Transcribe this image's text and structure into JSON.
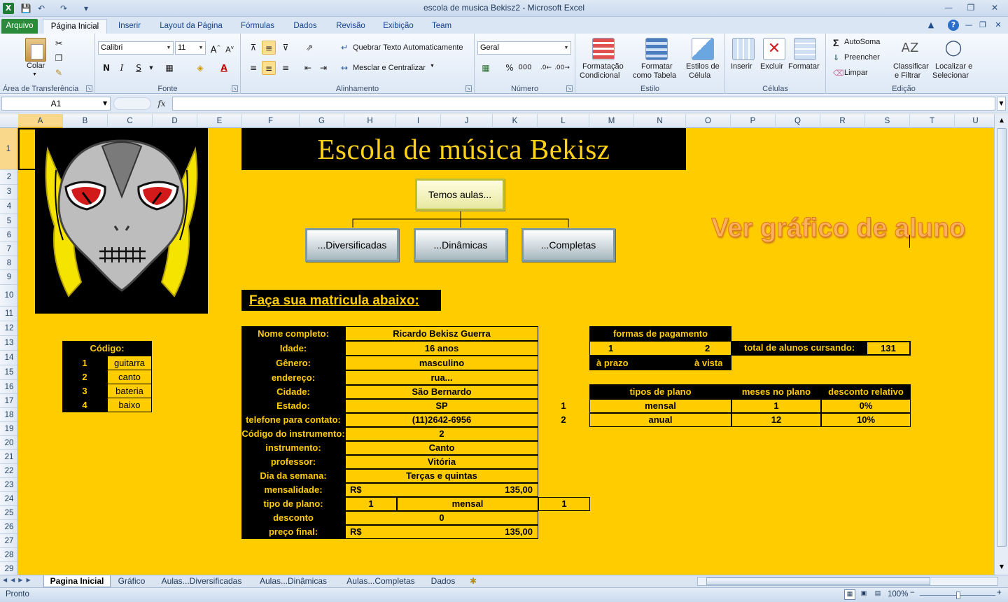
{
  "window": {
    "title": "escola de musica Bekisz2  -  Microsoft Excel"
  },
  "ribbon_tabs": [
    "Arquivo",
    "Página Inicial",
    "Inserir",
    "Layout da Página",
    "Fórmulas",
    "Dados",
    "Revisão",
    "Exibição",
    "Team"
  ],
  "ribbon": {
    "clipboard": {
      "colar": "Colar",
      "label": "Área de Transferência"
    },
    "font": {
      "name": "Calibri",
      "size": "11",
      "label": "Fonte",
      "bold": "N",
      "italic": "I",
      "underline": "S"
    },
    "alignment": {
      "wrap": "Quebrar Texto Automaticamente",
      "merge": "Mesclar e Centralizar",
      "label": "Alinhamento"
    },
    "number": {
      "format": "Geral",
      "label": "Número",
      "percent": "%",
      "thousands": "000"
    },
    "styles": {
      "cond1": "Formatação",
      "cond2": "Condicional",
      "table1": "Formatar",
      "table2": "como Tabela",
      "cell1": "Estilos de",
      "cell2": "Célula",
      "label": "Estilo"
    },
    "cells": {
      "insert": "Inserir",
      "delete": "Excluir",
      "format": "Formatar",
      "label": "Células"
    },
    "editing": {
      "autosum": "AutoSoma",
      "fill": "Preencher",
      "clear": "Limpar",
      "sort1": "Classificar",
      "sort2": "e Filtrar",
      "find1": "Localizar e",
      "find2": "Selecionar",
      "label": "Edição"
    }
  },
  "formula_bar": {
    "name_box": "A1",
    "fx": "fx",
    "value": ""
  },
  "columns": [
    "A",
    "B",
    "C",
    "D",
    "E",
    "F",
    "G",
    "H",
    "I",
    "J",
    "K",
    "L",
    "M",
    "N",
    "O",
    "P",
    "Q",
    "R",
    "S",
    "T",
    "U"
  ],
  "rows": [
    "1",
    "2",
    "3",
    "4",
    "5",
    "6",
    "7",
    "8",
    "9",
    "10",
    "11",
    "12",
    "13",
    "14",
    "15",
    "16",
    "17",
    "18",
    "19",
    "20",
    "21",
    "22",
    "23",
    "24",
    "25",
    "26",
    "27",
    "28",
    "29"
  ],
  "sheet": {
    "banner": "Escola de música Bekisz",
    "org": {
      "top": "Temos aulas...",
      "children": [
        "...Diversificadas",
        "...Dinâmicas",
        "...Completas"
      ]
    },
    "chart_link": "Ver gráfico de aluno",
    "enroll_title": "Faça sua matricula abaixo:",
    "codes": {
      "header": "Código:",
      "items": [
        {
          "n": "1",
          "name": "guitarra"
        },
        {
          "n": "2",
          "name": "canto"
        },
        {
          "n": "3",
          "name": "bateria"
        },
        {
          "n": "4",
          "name": "baixo"
        }
      ]
    },
    "form": [
      {
        "label": "Nome completo:",
        "value": "Ricardo Bekisz Guerra"
      },
      {
        "label": "Idade:",
        "value": "16 anos"
      },
      {
        "label": "Gênero:",
        "value": "masculino"
      },
      {
        "label": "endereço:",
        "value": "rua..."
      },
      {
        "label": "Cidade:",
        "value": "São Bernardo"
      },
      {
        "label": "Estado:",
        "value": "SP"
      },
      {
        "label": "telefone para contato:",
        "value": "(11)2642-6956"
      },
      {
        "label": "Código do instrumento:",
        "value": "2"
      },
      {
        "label": "instrumento:",
        "value": "Canto"
      },
      {
        "label": "professor:",
        "value": "Vitória"
      },
      {
        "label": "Dia da semana:",
        "value": "Terças e quintas"
      },
      {
        "label": "mensalidade:",
        "currency": "R$",
        "value": "135,00"
      },
      {
        "label": "tipo de plano:",
        "v1": "1",
        "v2": "mensal",
        "v3": "1"
      },
      {
        "label": "desconto",
        "value": "0"
      },
      {
        "label": "preço final:",
        "currency": "R$",
        "value": "135,00"
      }
    ],
    "side_numbers": [
      "1",
      "2"
    ],
    "payment": {
      "header": "formas de pagamento",
      "n1": "1",
      "n2": "2",
      "l1": "à prazo",
      "l2": "à vista"
    },
    "total": {
      "label": "total de alunos cursando:",
      "value": "131"
    },
    "plans": {
      "headers": [
        "tipos de plano",
        "meses no plano",
        "desconto relativo"
      ],
      "rows": [
        [
          "mensal",
          "1",
          "0%"
        ],
        [
          "anual",
          "12",
          "10%"
        ]
      ]
    }
  },
  "sheet_tabs": [
    "Pagina Inicial",
    "Gráfico",
    "Aulas...Diversificadas",
    "Aulas...Dinâmicas",
    "Aulas...Completas",
    "Dados"
  ],
  "status": {
    "ready": "Pronto",
    "zoom": "100%"
  }
}
